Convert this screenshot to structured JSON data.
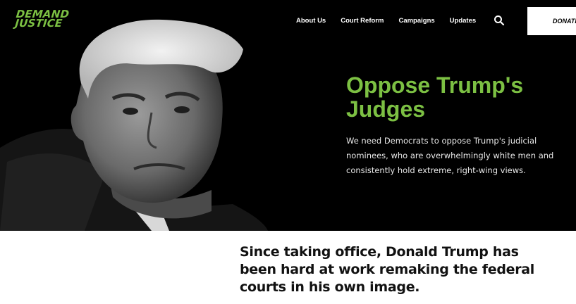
{
  "brand": {
    "line1": "DEMAND",
    "line2": "JUSTICE",
    "color": "#7cc043"
  },
  "nav": {
    "items": [
      {
        "label": "About Us"
      },
      {
        "label": "Court Reform"
      },
      {
        "label": "Campaigns"
      },
      {
        "label": "Updates"
      }
    ],
    "search_icon": "search-icon",
    "donate_label": "DONATE"
  },
  "hero": {
    "title": "Oppose Trump's Judges",
    "description": "We need Democrats to oppose Trump's judicial nominees, who are overwhelmingly white men and consistently hold extreme, right-wing views.",
    "background": "#000000",
    "accent": "#7cc043"
  },
  "intro": {
    "text": "Since taking office, Donald Trump has been hard at work remaking the federal courts in his own image."
  }
}
